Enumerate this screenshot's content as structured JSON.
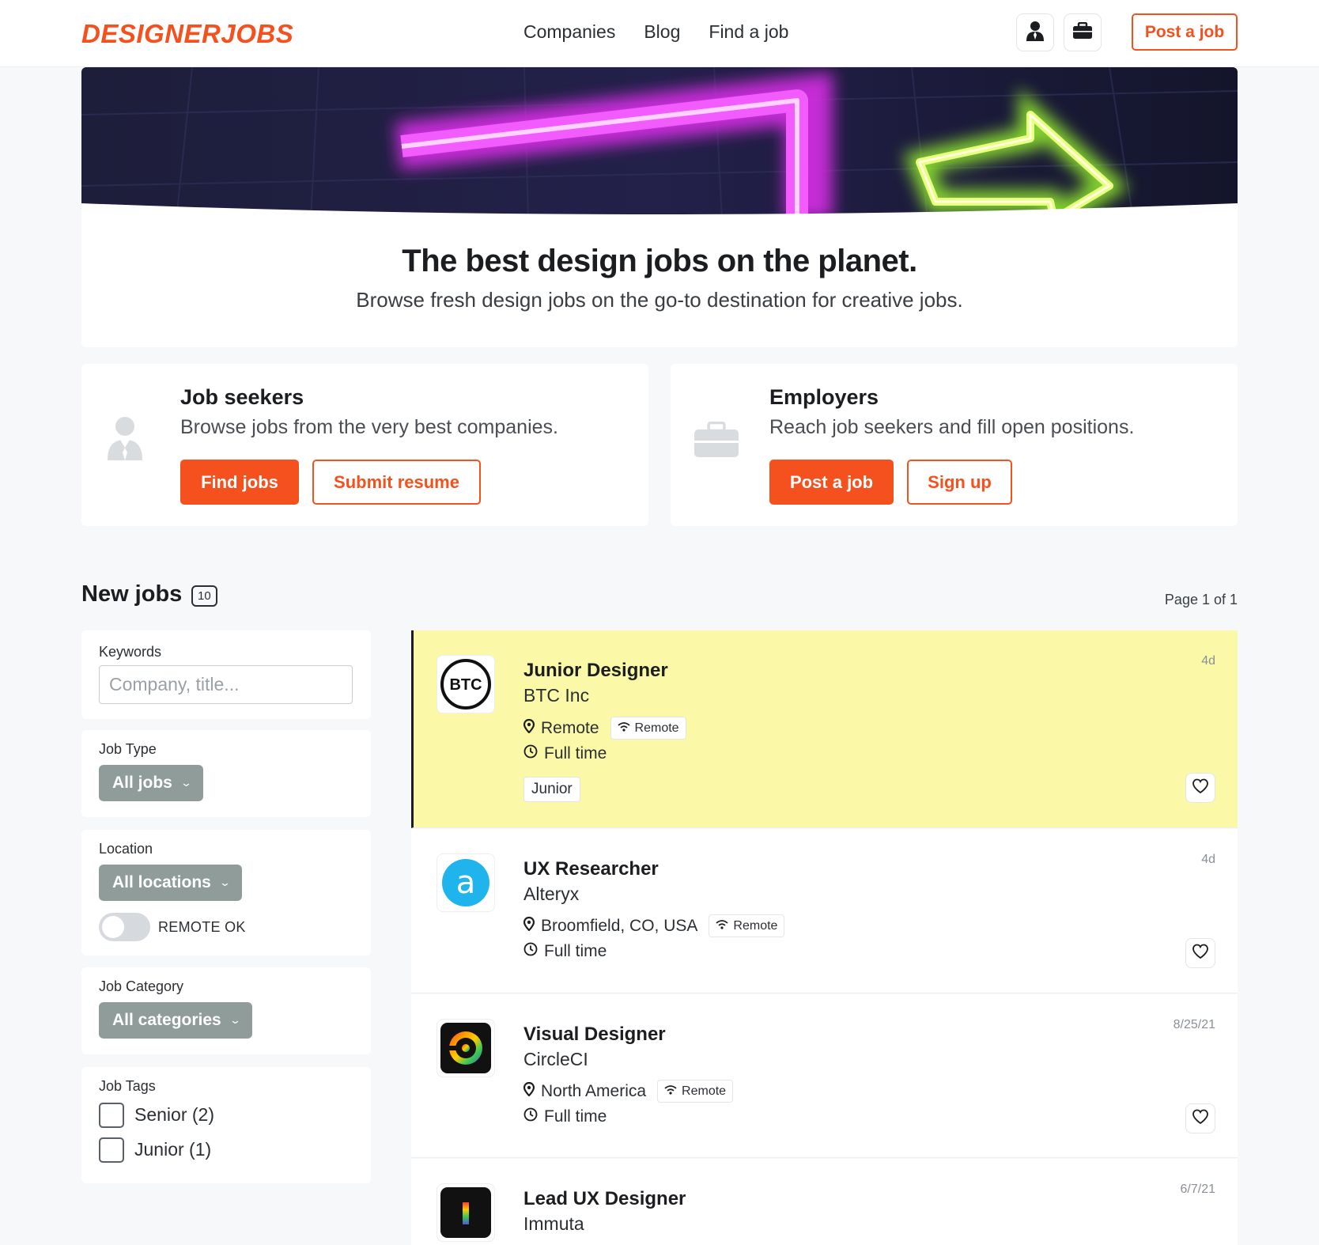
{
  "nav": {
    "logo": "DESIGNERJOBS",
    "links": [
      "Companies",
      "Blog",
      "Find a job"
    ],
    "post_job": "Post a job",
    "icons": [
      "person-icon",
      "briefcase-icon"
    ]
  },
  "hero": {
    "title": "The best design jobs on the planet.",
    "subtitle": "Browse fresh design jobs on the go-to destination for creative jobs."
  },
  "seekers": {
    "title": "Job seekers",
    "subtitle": "Browse jobs from the very best companies.",
    "primary": "Find jobs",
    "secondary": "Submit resume"
  },
  "employers": {
    "title": "Employers",
    "subtitle": "Reach job seekers and fill open positions.",
    "primary": "Post a job",
    "secondary": "Sign up"
  },
  "listing": {
    "heading": "New jobs",
    "count": "10",
    "page": "Page 1 of 1"
  },
  "filters": {
    "keywords_label": "Keywords",
    "keywords_placeholder": "Company, title...",
    "keywords_value": "",
    "job_type_label": "Job Type",
    "job_type_value": "All jobs",
    "location_label": "Location",
    "location_value": "All locations",
    "remote_label": "REMOTE OK",
    "remote_on": false,
    "category_label": "Job Category",
    "category_value": "All categories",
    "tags_label": "Job Tags",
    "tags": [
      {
        "label": "Senior (2)",
        "checked": false
      },
      {
        "label": "Junior (1)",
        "checked": false
      }
    ]
  },
  "jobs": [
    {
      "title": "Junior Designer",
      "company": "BTC Inc",
      "logo_text": "BTC",
      "location": "Remote",
      "remote_chip": "Remote",
      "type": "Full time",
      "tag": "Junior",
      "date": "4d",
      "featured": true
    },
    {
      "title": "UX Researcher",
      "company": "Alteryx",
      "logo_text": "a",
      "location": "Broomfield, CO, USA",
      "remote_chip": "Remote",
      "type": "Full time",
      "date": "4d",
      "featured": false
    },
    {
      "title": "Visual Designer",
      "company": "CircleCI",
      "location": "North America",
      "remote_chip": "Remote",
      "type": "Full time",
      "date": "8/25/21",
      "featured": false
    },
    {
      "title": "Lead UX Designer",
      "company": "Immuta",
      "date": "6/7/21",
      "featured": false
    }
  ],
  "colors": {
    "accent": "#f4511e",
    "featured_bg": "#fbf8a8",
    "select_bg": "#8f9c99",
    "page_bg": "#f7f8fa"
  }
}
